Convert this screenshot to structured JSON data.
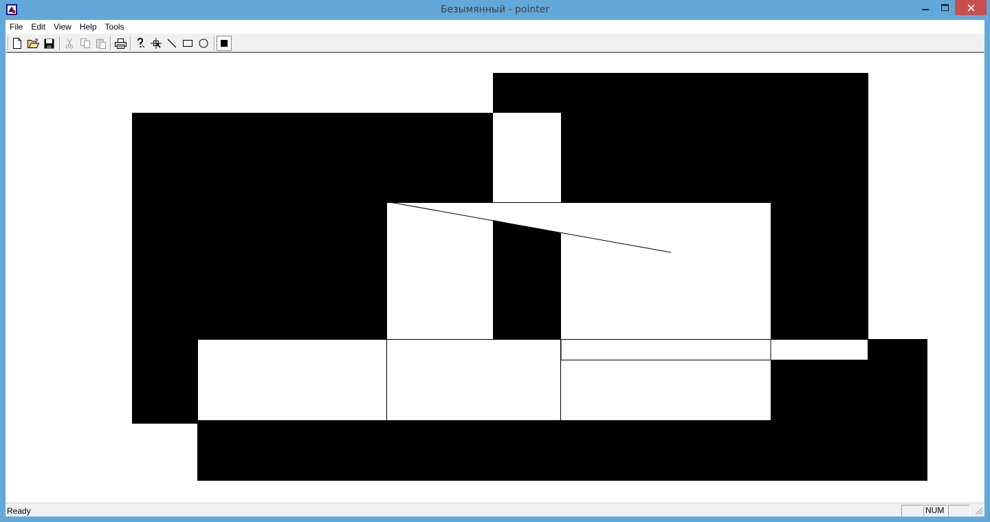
{
  "window": {
    "title": "Безымянный - pointer"
  },
  "menu": {
    "items": [
      "File",
      "Edit",
      "View",
      "Help",
      "Tools"
    ]
  },
  "toolbar": {
    "buttons": [
      {
        "name": "new-icon"
      },
      {
        "name": "open-folder-icon"
      },
      {
        "name": "save-icon"
      },
      {
        "name": "cut-icon",
        "disabled": true
      },
      {
        "name": "copy-icon",
        "disabled": true
      },
      {
        "name": "paste-icon",
        "disabled": true
      },
      {
        "name": "print-icon"
      },
      {
        "name": "help-question-icon"
      },
      {
        "name": "pointer-tool-icon"
      },
      {
        "name": "line-tool-icon"
      },
      {
        "name": "rectangle-tool-icon"
      },
      {
        "name": "ellipse-tool-icon"
      },
      {
        "name": "fill-color-icon",
        "selected": true
      }
    ]
  },
  "status": {
    "text": "Ready",
    "num": "NUM"
  },
  "colors": {
    "titlebar": "#62a8d9",
    "close_button": "#c74f50",
    "fill": "#000000",
    "canvas": "#ffffff"
  }
}
